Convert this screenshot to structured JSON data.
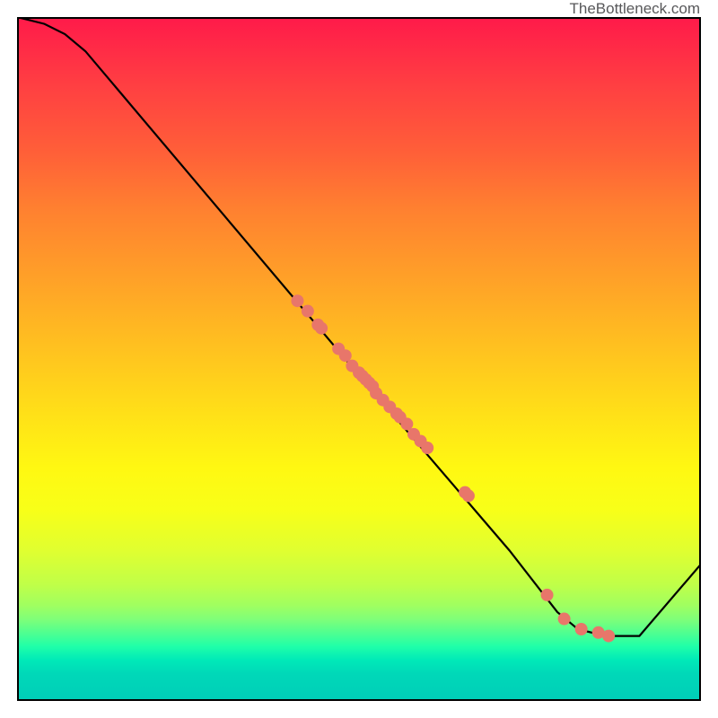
{
  "watermark": "TheBottleneck.com",
  "chart_data": {
    "type": "line",
    "title": "",
    "xlabel": "",
    "ylabel": "",
    "xlim": [
      0,
      100
    ],
    "ylim": [
      0,
      100
    ],
    "axes_visible": false,
    "grid": false,
    "background_gradient": {
      "top": "#ff1a4a",
      "mid": "#ffe018",
      "bottom": "#00ceb8"
    },
    "series": [
      {
        "name": "curve",
        "color": "#000000",
        "x": [
          0,
          4,
          7,
          10,
          48,
          60,
          66,
          72,
          79,
          82,
          86,
          91,
          100
        ],
        "y": [
          100,
          99,
          97.5,
          95,
          50,
          36,
          29,
          22,
          13,
          10.5,
          9.5,
          9.5,
          20
        ]
      }
    ],
    "scatter_points": {
      "name": "markers",
      "color": "#e8766a",
      "radius_px": 7,
      "x": [
        41,
        42.5,
        44,
        44.5,
        47,
        48,
        49,
        50,
        50.5,
        51,
        51.5,
        52,
        52.5,
        53.5,
        54.5,
        55.5,
        56,
        57,
        58,
        59,
        60,
        65.5,
        66,
        77.5,
        80,
        82.5,
        85,
        86.5
      ],
      "y": [
        58.5,
        57,
        55,
        54.5,
        51.5,
        50.5,
        49,
        48,
        47.5,
        47,
        46.5,
        46,
        45,
        44,
        43,
        42,
        41.5,
        40.5,
        39,
        38,
        37,
        30.5,
        30,
        15.5,
        12,
        10.5,
        10,
        9.5
      ]
    }
  }
}
